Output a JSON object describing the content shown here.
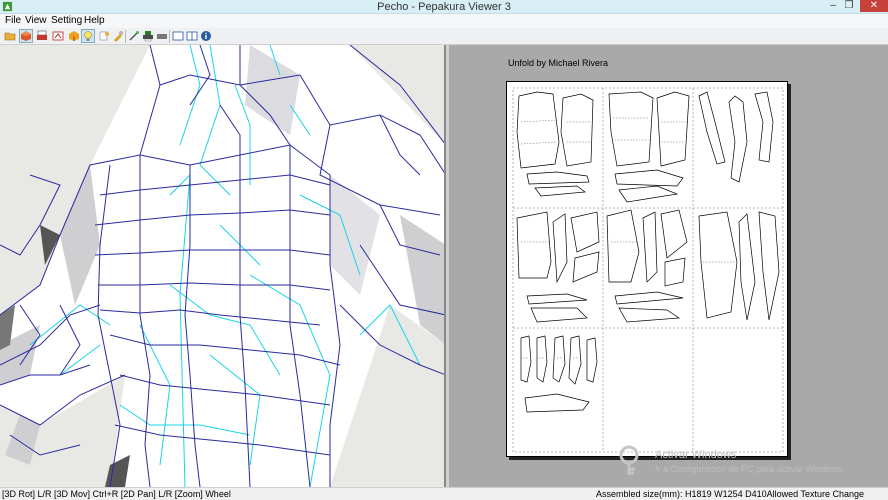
{
  "window": {
    "title": "Pecho - Pepakura Viewer 3",
    "minimize_glyph": "–",
    "restore_glyph": "❐"
  },
  "menu": {
    "items": [
      "File",
      "View",
      "Setting",
      "Help"
    ]
  },
  "toolbar": {
    "icons": [
      "open-folder-icon",
      "3d-view-icon",
      "print-icon",
      "2d-view-icon",
      "texture-icon",
      "lightbulb-icon",
      "paint-icon",
      "tool-icon",
      "magic-icon",
      "print-preview-icon",
      "single-view-icon",
      "split-view-icon",
      "info-icon"
    ]
  },
  "view2d": {
    "unfold_label": "Unfold by Michael Rivera",
    "watermark_title": "Activar Windows",
    "watermark_sub": "Ir a Configuración de PC para activar Windows."
  },
  "status": {
    "left": "[3D Rot] L/R [3D Mov] Ctrl+R [2D Pan] L/R [Zoom] Wheel",
    "right": "Assembled size(mm): H1819 W1254 D410Allowed Texture Change"
  },
  "colors": {
    "mesh_edge": "#2a2aa0",
    "fold_line": "#19d4e8",
    "background_3d": "#e8e8e4"
  }
}
